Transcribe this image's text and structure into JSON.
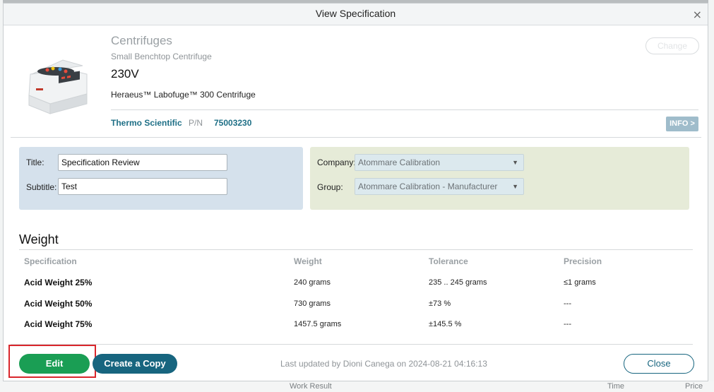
{
  "dialog": {
    "title": "View Specification",
    "close_glyph": "×"
  },
  "product": {
    "category": "Centrifuges",
    "subcategory": "Small Benchtop Centrifuge",
    "voltage": "230V",
    "name": "Heraeus™ Labofuge™ 300 Centrifuge",
    "brand": "Thermo Scientific",
    "pn_label": "P/N",
    "pn_value": "75003230",
    "change_label": "Change",
    "info_label": "INFO >"
  },
  "form": {
    "title_label": "Title:",
    "title_value": "Specification Review",
    "subtitle_label": "Subtitle:",
    "subtitle_value": "Test",
    "company_label": "Company:",
    "company_value": "Atommare Calibration",
    "group_label": "Group:",
    "group_value": "Atommare Calibration - Manufacturer"
  },
  "weight": {
    "section_title": "Weight",
    "columns": [
      "Specification",
      "Weight",
      "Tolerance",
      "Precision"
    ],
    "rows": [
      {
        "specification": "Acid Weight 25%",
        "weight": "240 grams",
        "tolerance": "235 .. 245 grams",
        "precision": "≤1 grams"
      },
      {
        "specification": "Acid Weight 50%",
        "weight": "730 grams",
        "tolerance": "±73 %",
        "precision": "---"
      },
      {
        "specification": "Acid Weight 75%",
        "weight": "1457.5 grams",
        "tolerance": "±145.5 %",
        "precision": "---"
      }
    ]
  },
  "footer": {
    "edit_label": "Edit",
    "copy_label": "Create a Copy",
    "last_updated": "Last updated by Dioni Canega on 2024-08-21 04:16:13",
    "close_label": "Close"
  },
  "background": {
    "bottom_left": "Work Result",
    "bottom_mid": "Time",
    "bottom_right": "Price"
  },
  "colors": {
    "accent": "#17657f",
    "edit_green": "#1a9e54",
    "highlight_red": "#d9262c",
    "panel_blue": "#d5e1ec",
    "panel_green": "#e6ebd8"
  }
}
